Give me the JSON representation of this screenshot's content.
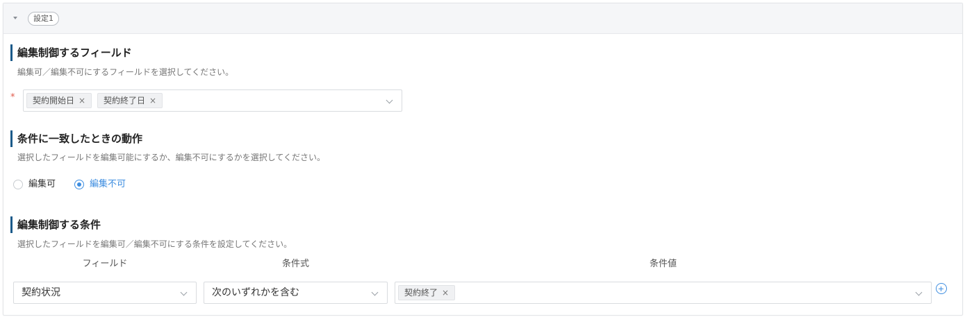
{
  "header": {
    "setting_label": "設定1"
  },
  "fields_section": {
    "title": "編集制御するフィールド",
    "description": "編集可／編集不可にするフィールドを選択してください。",
    "required_mark": "*",
    "selected_tags": [
      "契約開始日",
      "契約終了日"
    ]
  },
  "action_section": {
    "title": "条件に一致したときの動作",
    "description": "選択したフィールドを編集可能にするか、編集不可にするかを選択してください。",
    "options": [
      {
        "label": "編集可",
        "checked": false
      },
      {
        "label": "編集不可",
        "checked": true
      }
    ]
  },
  "condition_section": {
    "title": "編集制御する条件",
    "description": "選択したフィールドを編集可／編集不可にする条件を設定してください。",
    "columns": [
      "フィールド",
      "条件式",
      "条件値"
    ],
    "row": {
      "field": "契約状況",
      "operator": "次のいずれかを含む",
      "value_tags": [
        "契約終了"
      ]
    }
  },
  "tag_remove_glyph": "×",
  "colors": {
    "accent": "#3d8de0",
    "title_bar": "#1b5a8a",
    "required": "#e05a4b"
  }
}
